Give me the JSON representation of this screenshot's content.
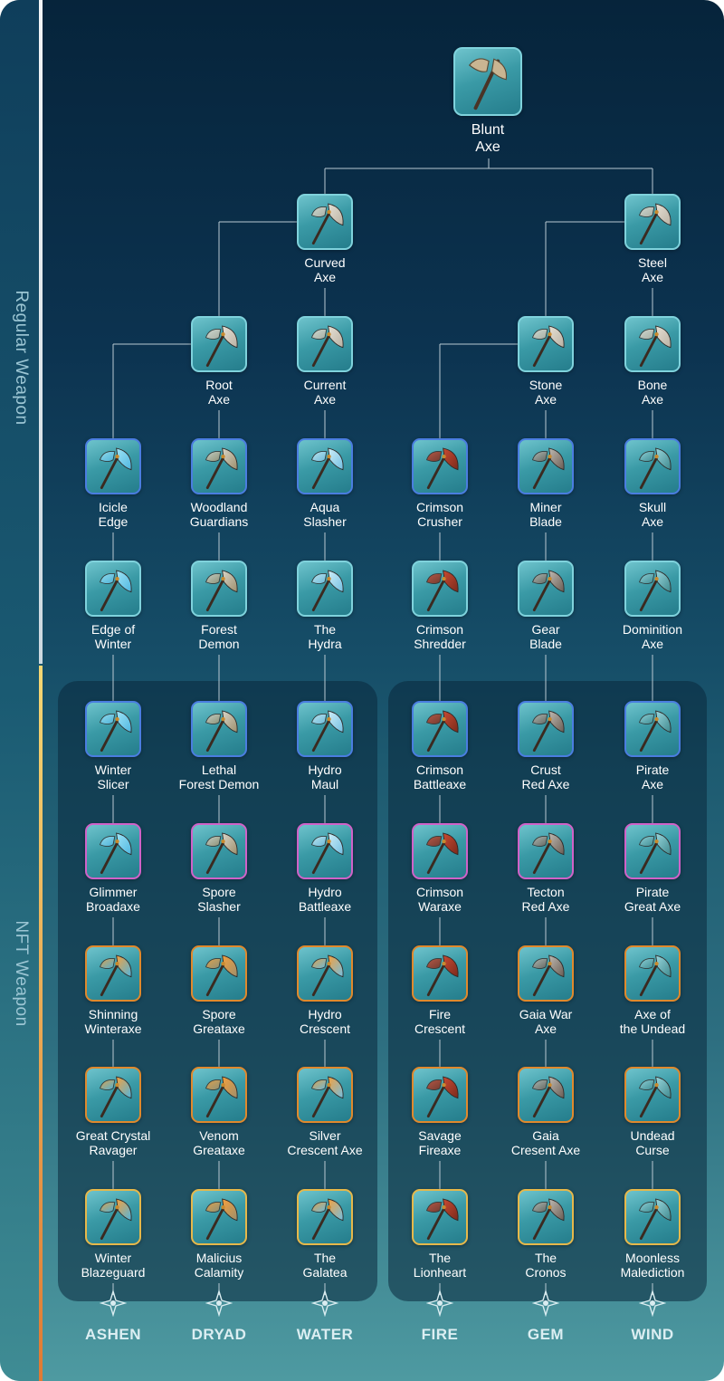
{
  "sections": {
    "regular": "Regular Weapon",
    "nft": "NFT Weapon"
  },
  "root": {
    "line1": "Blunt",
    "line2": "Axe"
  },
  "nodes": [
    {
      "id": "curved-axe",
      "line1": "Curved",
      "line2": "Axe",
      "rarity": "common"
    },
    {
      "id": "steel-axe",
      "line1": "Steel",
      "line2": "Axe",
      "rarity": "common"
    },
    {
      "id": "root-axe",
      "line1": "Root",
      "line2": "Axe",
      "rarity": "common"
    },
    {
      "id": "current-axe",
      "line1": "Current",
      "line2": "Axe",
      "rarity": "common"
    },
    {
      "id": "stone-axe",
      "line1": "Stone",
      "line2": "Axe",
      "rarity": "common"
    },
    {
      "id": "bone-axe",
      "line1": "Bone",
      "line2": "Axe",
      "rarity": "common"
    },
    {
      "id": "icicle-edge",
      "line1": "Icicle",
      "line2": "Edge",
      "rarity": "rare"
    },
    {
      "id": "woodland-guardians",
      "line1": "Woodland",
      "line2": "Guardians",
      "rarity": "rare"
    },
    {
      "id": "aqua-slasher",
      "line1": "Aqua",
      "line2": "Slasher",
      "rarity": "rare"
    },
    {
      "id": "crimson-crusher",
      "line1": "Crimson",
      "line2": "Crusher",
      "rarity": "rare"
    },
    {
      "id": "miner-blade",
      "line1": "Miner",
      "line2": "Blade",
      "rarity": "rare"
    },
    {
      "id": "skull-axe",
      "line1": "Skull",
      "line2": "Axe",
      "rarity": "rare"
    },
    {
      "id": "edge-of-winter",
      "line1": "Edge of",
      "line2": "Winter",
      "rarity": "common"
    },
    {
      "id": "forest-demon",
      "line1": "Forest",
      "line2": "Demon",
      "rarity": "common"
    },
    {
      "id": "the-hydra",
      "line1": "The",
      "line2": "Hydra",
      "rarity": "common"
    },
    {
      "id": "crimson-shredder",
      "line1": "Crimson",
      "line2": "Shredder",
      "rarity": "common"
    },
    {
      "id": "gear-blade",
      "line1": "Gear",
      "line2": "Blade",
      "rarity": "common"
    },
    {
      "id": "dominition-axe",
      "line1": "Dominition",
      "line2": "Axe",
      "rarity": "common"
    },
    {
      "id": "winter-slicer",
      "line1": "Winter",
      "line2": "Slicer",
      "rarity": "rare"
    },
    {
      "id": "lethal-forest-demon",
      "line1": "Lethal",
      "line2": "Forest Demon",
      "rarity": "rare"
    },
    {
      "id": "hydro-maul",
      "line1": "Hydro",
      "line2": "Maul",
      "rarity": "rare"
    },
    {
      "id": "crimson-battleaxe",
      "line1": "Crimson",
      "line2": "Battleaxe",
      "rarity": "rare"
    },
    {
      "id": "crust-red-axe",
      "line1": "Crust",
      "line2": "Red Axe",
      "rarity": "rare"
    },
    {
      "id": "pirate-axe",
      "line1": "Pirate",
      "line2": "Axe",
      "rarity": "rare"
    },
    {
      "id": "glimmer-broadaxe",
      "line1": "Glimmer",
      "line2": "Broadaxe",
      "rarity": "epic"
    },
    {
      "id": "spore-slasher",
      "line1": "Spore",
      "line2": "Slasher",
      "rarity": "epic"
    },
    {
      "id": "hydro-battleaxe",
      "line1": "Hydro",
      "line2": "Battleaxe",
      "rarity": "epic"
    },
    {
      "id": "crimson-waraxe",
      "line1": "Crimson",
      "line2": "Waraxe",
      "rarity": "epic"
    },
    {
      "id": "tecton-red-axe",
      "line1": "Tecton",
      "line2": "Red Axe",
      "rarity": "epic"
    },
    {
      "id": "pirate-great-axe",
      "line1": "Pirate",
      "line2": "Great Axe",
      "rarity": "epic"
    },
    {
      "id": "shinning-winteraxe",
      "line1": "Shinning",
      "line2": "Winteraxe",
      "rarity": "legendary"
    },
    {
      "id": "spore-greataxe",
      "line1": "Spore",
      "line2": "Greataxe",
      "rarity": "legendary"
    },
    {
      "id": "hydro-crescent",
      "line1": "Hydro",
      "line2": "Crescent",
      "rarity": "legendary"
    },
    {
      "id": "fire-crescent",
      "line1": "Fire",
      "line2": "Crescent",
      "rarity": "legendary"
    },
    {
      "id": "gaia-war-axe",
      "line1": "Gaia War",
      "line2": "Axe",
      "rarity": "legendary"
    },
    {
      "id": "axe-of-the-undead",
      "line1": "Axe of",
      "line2": "the Undead",
      "rarity": "legendary"
    },
    {
      "id": "great-crystal-ravager",
      "line1": "Great Crystal",
      "line2": "Ravager",
      "rarity": "legendary"
    },
    {
      "id": "venom-greataxe",
      "line1": "Venom",
      "line2": "Greataxe",
      "rarity": "legendary"
    },
    {
      "id": "silver-crescent-axe",
      "line1": "Silver",
      "line2": "Crescent Axe",
      "rarity": "legendary"
    },
    {
      "id": "savage-fireaxe",
      "line1": "Savage",
      "line2": "Fireaxe",
      "rarity": "legendary"
    },
    {
      "id": "gaia-cresent-axe",
      "line1": "Gaia",
      "line2": "Cresent Axe",
      "rarity": "legendary"
    },
    {
      "id": "undead-curse",
      "line1": "Undead",
      "line2": "Curse",
      "rarity": "legendary"
    },
    {
      "id": "winter-blazeguard",
      "line1": "Winter",
      "line2": "Blazeguard",
      "rarity": "mythic"
    },
    {
      "id": "malicius-calamity",
      "line1": "Malicius",
      "line2": "Calamity",
      "rarity": "mythic"
    },
    {
      "id": "the-galatea",
      "line1": "The",
      "line2": "Galatea",
      "rarity": "mythic"
    },
    {
      "id": "the-lionheart",
      "line1": "The",
      "line2": "Lionheart",
      "rarity": "mythic"
    },
    {
      "id": "the-cronos",
      "line1": "The",
      "line2": "Cronos",
      "rarity": "mythic"
    },
    {
      "id": "moonless-malediction",
      "line1": "Moonless",
      "line2": "Malediction",
      "rarity": "mythic"
    }
  ],
  "elements": [
    "ASHEN",
    "DRYAD",
    "WATER",
    "FIRE",
    "GEM",
    "WIND"
  ],
  "colors": {
    "frame_common": "#7fd2dc",
    "frame_rare": "#4a7de0",
    "frame_epic": "#d062c8",
    "frame_legendary": "#e0892c",
    "frame_mythic": "#e6b84a",
    "regular_bar": "#e9eef2",
    "nft_bar_top": "#f4d774",
    "nft_bar_bottom": "#e07a33"
  }
}
